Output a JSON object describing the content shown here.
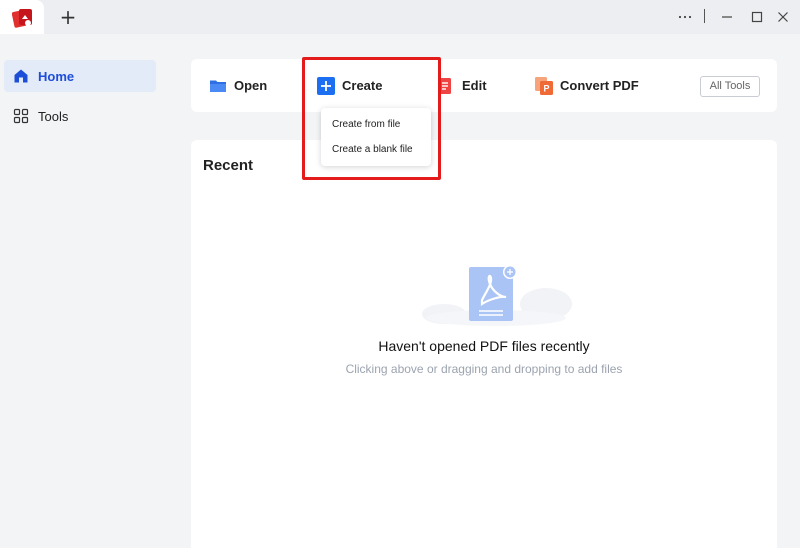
{
  "titlebar": {
    "new_tab_icon": "plus-icon",
    "controls": [
      "more-icon",
      "minimize-icon",
      "maximize-icon",
      "close-icon"
    ]
  },
  "sidebar": {
    "items": [
      {
        "label": "Home",
        "icon": "home-icon",
        "active": true
      },
      {
        "label": "Tools",
        "icon": "grid-icon",
        "active": false
      }
    ]
  },
  "toolbar": {
    "open_label": "Open",
    "create_label": "Create",
    "edit_label": "Edit",
    "convert_label": "Convert PDF",
    "all_tools_label": "All Tools"
  },
  "create_menu": {
    "items": [
      "Create from file",
      "Create a blank file"
    ]
  },
  "recent": {
    "title": "Recent",
    "empty_title": "Haven't opened PDF files recently",
    "empty_subtitle": "Clicking above or dragging and dropping to add files"
  },
  "colors": {
    "accent": "#1d4ed8",
    "highlight": "#e31b1b",
    "convert": "#f06a35",
    "edit": "#ef4444"
  }
}
